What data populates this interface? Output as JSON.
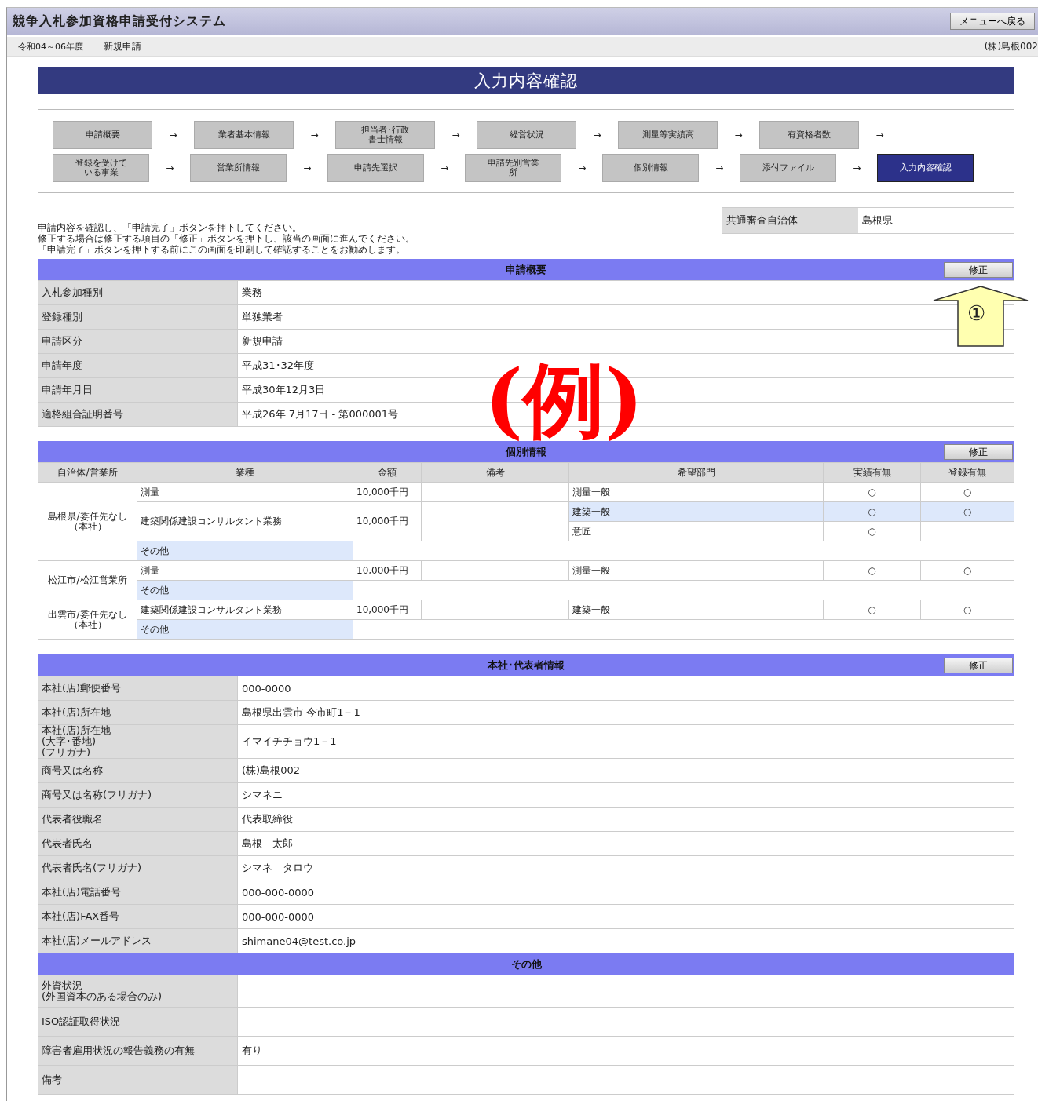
{
  "header": {
    "title": "競争入札参加資格申請受付システム",
    "menu_button": "メニューへ戻る"
  },
  "subbar": {
    "period": "令和04～06年度",
    "mode": "新規申請",
    "user": "(株)島根002"
  },
  "page_title": "入力内容確認",
  "step_rows": [
    [
      {
        "label": "申請概要",
        "selected": false,
        "arrow": "→"
      },
      {
        "label": "業者基本情報",
        "selected": false,
        "arrow": "→"
      },
      {
        "label": "担当者･行政書士情報",
        "selected": false,
        "arrow": "→"
      },
      {
        "label": "経営状況",
        "selected": false,
        "arrow": "→"
      },
      {
        "label": "測量等実績高",
        "selected": false,
        "arrow": "→"
      },
      {
        "label": "有資格者数",
        "selected": false,
        "arrow": "→"
      }
    ],
    [
      {
        "label": "登録を受けている事業",
        "selected": false,
        "arrow": "→"
      },
      {
        "label": "営業所情報",
        "selected": false,
        "arrow": "→"
      },
      {
        "label": "申請先選択",
        "selected": false,
        "arrow": "→"
      },
      {
        "label": "申請先別営業所",
        "selected": false,
        "arrow": "→"
      },
      {
        "label": "個別情報",
        "selected": false,
        "arrow": "→"
      },
      {
        "label": "添付ファイル",
        "selected": false,
        "arrow": "→"
      },
      {
        "label": "入力内容確認",
        "selected": true
      }
    ]
  ],
  "instructions": [
    "申請内容を確認し、「申請完了」ボタンを押下してください。",
    "修正する場合は修正する項目の「修正」ボタンを押下し、該当の画面に進んでください。",
    "「申請完了」ボタンを押下する前にこの画面を印刷して確認することをお勧めします。"
  ],
  "joint_review": {
    "label": "共通審査自治体",
    "value": "島根県"
  },
  "sections": [
    {
      "kind": "fields",
      "title": "申請概要",
      "edit_button": "修正",
      "rows": [
        {
          "label": "入札参加種別",
          "value": "業務"
        },
        {
          "label": "登録種別",
          "value": "単独業者"
        },
        {
          "label": "申請区分",
          "value": "新規申請"
        },
        {
          "label": "申請年度",
          "value": "平成31･32年度"
        },
        {
          "label": "申請年月日",
          "value": "平成30年12月3日"
        },
        {
          "label": "適格組合証明番号",
          "value": "平成26年 7月17日 - 第000001号"
        }
      ]
    },
    {
      "kind": "grid",
      "title": "個別情報",
      "edit_button": "修正",
      "columns": [
        "自治体/営業所",
        "業種",
        "金額",
        "備考",
        "希望部門",
        "実績有無",
        "登録有無"
      ],
      "groups": [
        {
          "office": "島根県/委任先なし（本社）",
          "lines": [
            {
              "industry": "測量",
              "amount": "10,000千円",
              "departments": [
                {
                  "name": "測量一般",
                  "record": "○",
                  "registered": "○",
                  "highlighted": false
                }
              ]
            },
            {
              "industry": "建築関係建設コンサルタント業務",
              "amount": "10,000千円",
              "departments": [
                {
                  "name": "建築一般",
                  "record": "○",
                  "registered": "○",
                  "highlighted": true
                },
                {
                  "name": "意匠",
                  "record": "○",
                  "highlighted": false
                }
              ]
            }
          ],
          "other": "その他"
        },
        {
          "office": "松江市/松江営業所",
          "lines": [
            {
              "industry": "測量",
              "amount": "10,000千円",
              "departments": [
                {
                  "name": "測量一般",
                  "record": "○",
                  "registered": "○",
                  "highlighted": false
                }
              ]
            }
          ],
          "other": "その他"
        },
        {
          "office": "出雲市/委任先なし（本社）",
          "lines": [
            {
              "industry": "建築関係建設コンサルタント業務",
              "amount": "10,000千円",
              "departments": [
                {
                  "name": "建築一般",
                  "record": "○",
                  "registered": "○",
                  "highlighted": false
                }
              ]
            }
          ],
          "other": "その他"
        }
      ]
    },
    {
      "kind": "fields",
      "title": "本社･代表者情報",
      "edit_button": "修正",
      "rows": [
        {
          "label": "本社(店)郵便番号",
          "value": "000-0000"
        },
        {
          "label": "本社(店)所在地",
          "value": "島根県出雲市 今市町1－1"
        },
        {
          "label": "本社(店)所在地\n(大字･番地)\n(フリガナ)",
          "value": "イマイチチョウ1－1"
        },
        {
          "label": "商号又は名称",
          "value": "(株)島根002"
        },
        {
          "label": "商号又は名称(フリガナ)",
          "value": "シマネニ"
        },
        {
          "label": "代表者役職名",
          "value": "代表取締役"
        },
        {
          "label": "代表者氏名",
          "value": "島根　太郎"
        },
        {
          "label": "代表者氏名(フリガナ)",
          "value": "シマネ　タロウ"
        },
        {
          "label": "本社(店)電話番号",
          "value": "000-000-0000"
        },
        {
          "label": "本社(店)FAX番号",
          "value": "000-000-0000"
        },
        {
          "label": "本社(店)メールアドレス",
          "value": "shimane04@test.co.jp"
        }
      ]
    },
    {
      "kind": "fields",
      "title": "その他",
      "rows": [
        {
          "label": "外資状況\n(外国資本のある場合のみ)"
        },
        {
          "label": "ISO認証取得状況"
        },
        {
          "label": "障害者雇用状況の報告義務の有無",
          "value": "有り"
        },
        {
          "label": "備考"
        }
      ]
    }
  ],
  "example_stamp": "(例)",
  "callout": {
    "number": "①"
  }
}
